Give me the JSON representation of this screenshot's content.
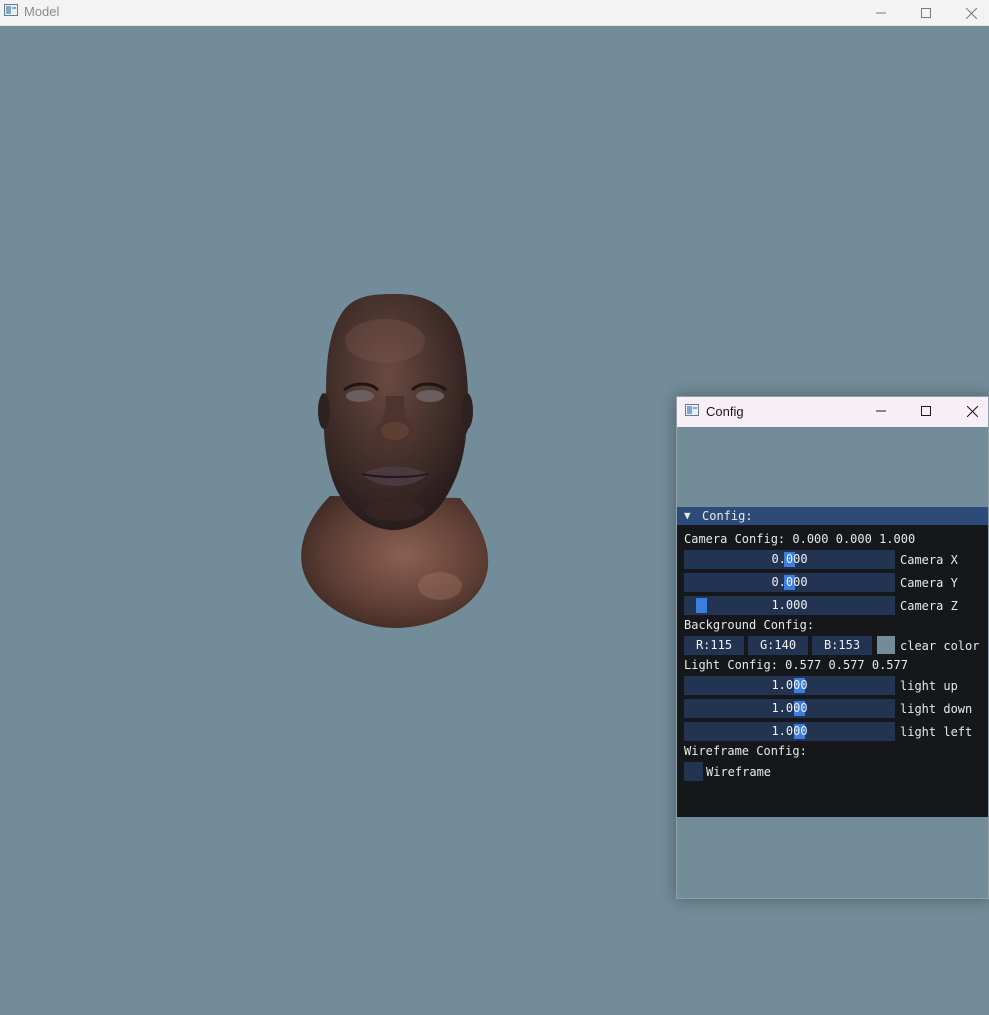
{
  "main_window": {
    "title": "Model",
    "background_color": "#738c99"
  },
  "config_window": {
    "title": "Config",
    "section_header": "Config:",
    "camera": {
      "summary": "Camera Config: 0.000 0.000 1.000",
      "sliders": [
        {
          "value": "0.000",
          "label": "Camera X",
          "fraction": 0.5
        },
        {
          "value": "0.000",
          "label": "Camera Y",
          "fraction": 0.5
        },
        {
          "value": "1.000",
          "label": "Camera Z",
          "fraction": 0.05
        }
      ]
    },
    "background": {
      "summary": "Background Config:",
      "r": "R:115",
      "g": "G:140",
      "b": "B:153",
      "label": "clear color",
      "swatch_color": "#738c99"
    },
    "light": {
      "summary": "Light Config: 0.577 0.577 0.577",
      "sliders": [
        {
          "value": "1.000",
          "label": "light up",
          "fraction": 0.55
        },
        {
          "value": "1.000",
          "label": "light down",
          "fraction": 0.55
        },
        {
          "value": "1.000",
          "label": "light left",
          "fraction": 0.55
        }
      ]
    },
    "wireframe": {
      "summary": "Wireframe Config:",
      "checkbox_label": "Wireframe",
      "checked": false
    }
  },
  "colors": {
    "imgui_bg": "#15171b",
    "imgui_frame": "#233453",
    "imgui_header": "#2c4b78",
    "imgui_grab": "#3c7de0"
  },
  "icons": {
    "minimize": "minimize-icon",
    "maximize": "maximize-icon",
    "close": "close-icon",
    "collapse": "collapse-arrow-icon"
  }
}
